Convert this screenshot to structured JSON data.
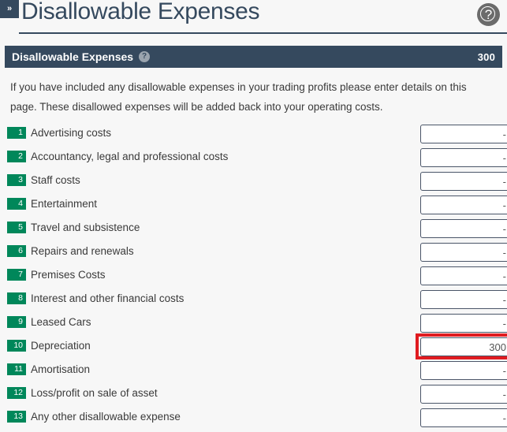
{
  "window": {
    "sidebar_toggle_label": "»",
    "page_title": "Disallowable Expenses",
    "help_icon": "help-circle-icon"
  },
  "section": {
    "title": "Disallowable Expenses",
    "help_icon": "question-mark-icon",
    "help_label": "?",
    "total": "300"
  },
  "intro": {
    "text": "If you have included any disallowable expenses in your trading profits please enter details on this page. These disallowed expenses will be added back into your operating costs."
  },
  "colors": {
    "header_navy": "#35495e",
    "badge_green": "#00875a",
    "highlight_red": "#e01b20",
    "page_background": "#f7f7f7"
  },
  "rows": [
    {
      "num": "1",
      "label": "Advertising costs",
      "value": "-",
      "highlighted": false
    },
    {
      "num": "2",
      "label": "Accountancy, legal and professional costs",
      "value": "-",
      "highlighted": false
    },
    {
      "num": "3",
      "label": "Staff costs",
      "value": "-",
      "highlighted": false
    },
    {
      "num": "4",
      "label": "Entertainment",
      "value": "-",
      "highlighted": false
    },
    {
      "num": "5",
      "label": "Travel and subsistence",
      "value": "-",
      "highlighted": false
    },
    {
      "num": "6",
      "label": "Repairs and renewals",
      "value": "-",
      "highlighted": false
    },
    {
      "num": "7",
      "label": "Premises Costs",
      "value": "-",
      "highlighted": false
    },
    {
      "num": "8",
      "label": "Interest and other financial costs",
      "value": "-",
      "highlighted": false
    },
    {
      "num": "9",
      "label": "Leased Cars",
      "value": "-",
      "highlighted": false
    },
    {
      "num": "10",
      "label": "Depreciation",
      "value": "300",
      "highlighted": true
    },
    {
      "num": "11",
      "label": "Amortisation",
      "value": "-",
      "highlighted": false
    },
    {
      "num": "12",
      "label": "Loss/profit on sale of asset",
      "value": "-",
      "highlighted": false
    },
    {
      "num": "13",
      "label": "Any other disallowable expense",
      "value": "-",
      "highlighted": false
    }
  ]
}
